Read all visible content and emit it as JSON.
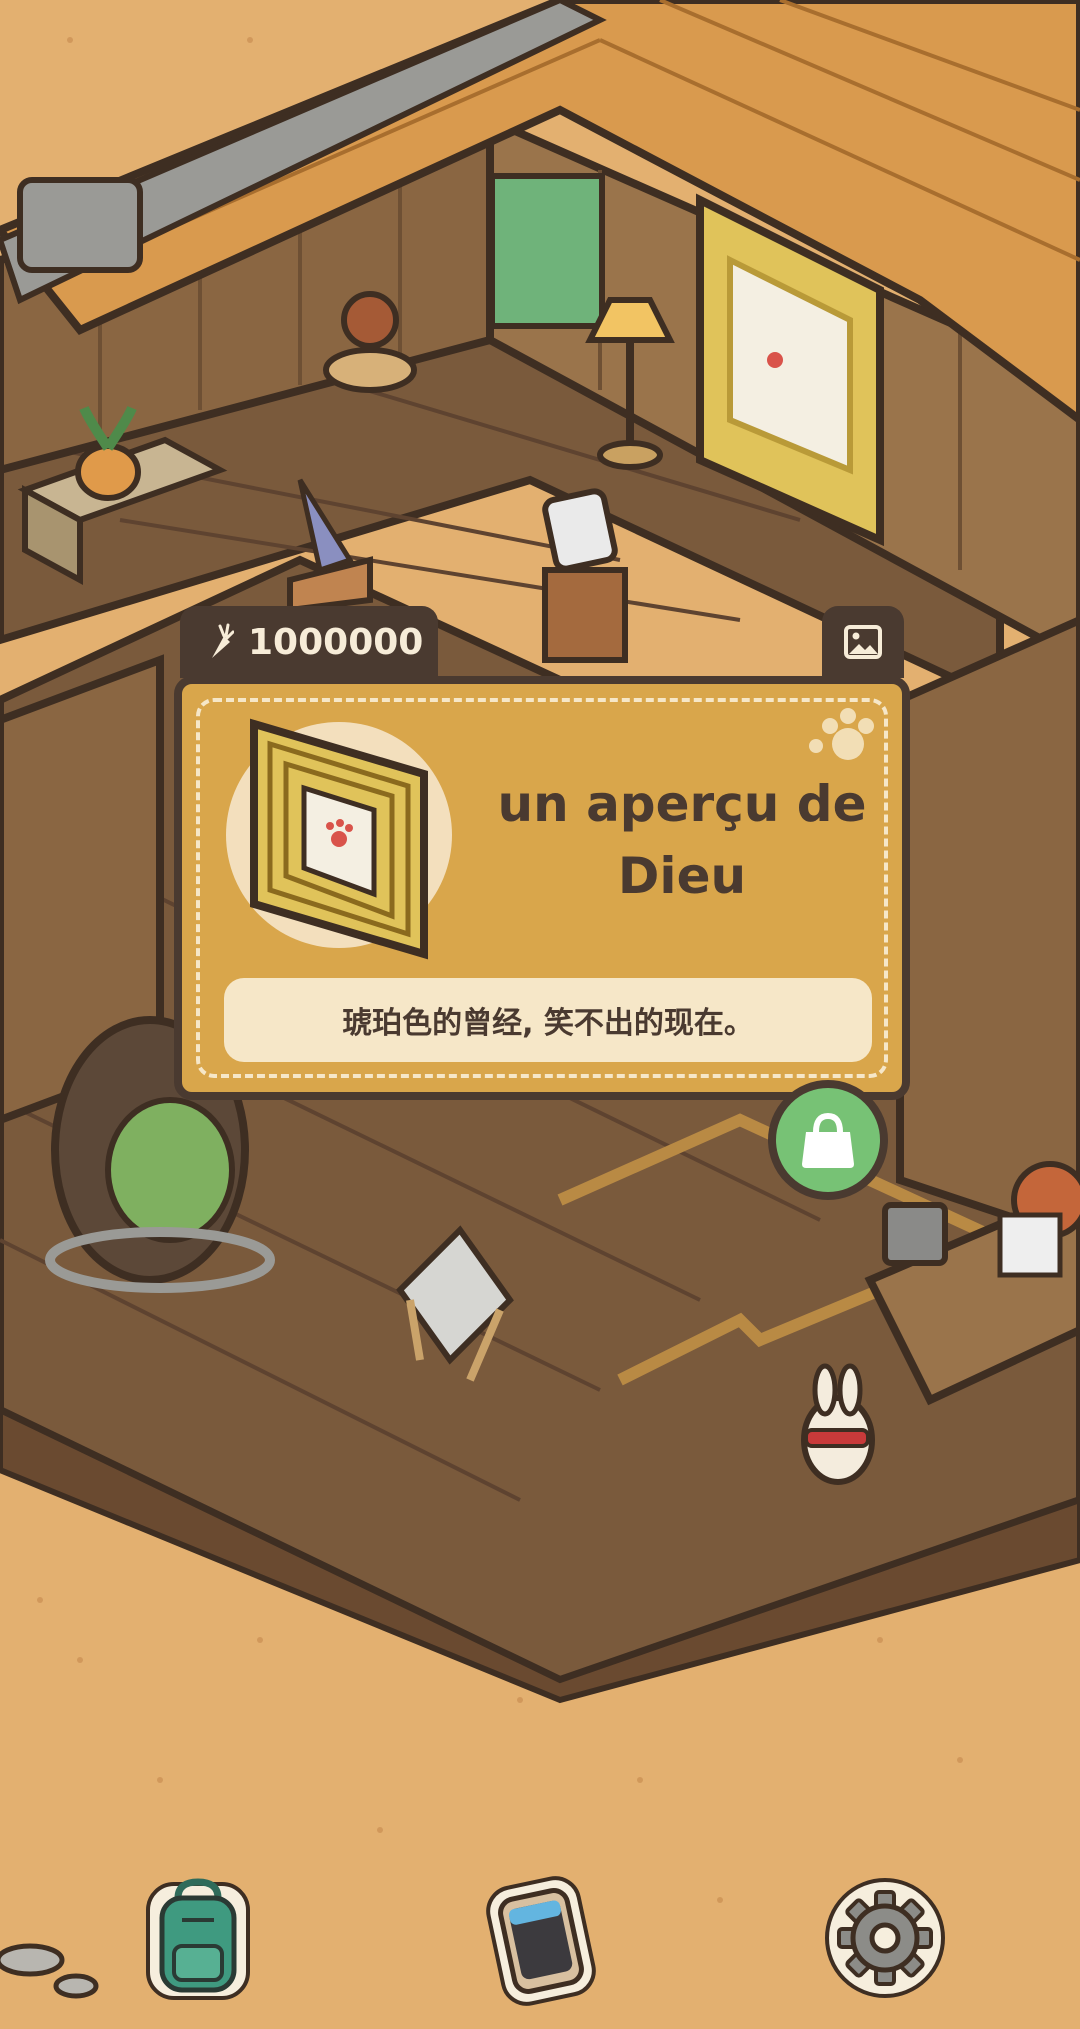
{
  "currency": {
    "icon": "carrot-icon",
    "amount": "1000000"
  },
  "photo_button": {
    "icon": "photo-icon"
  },
  "item_card": {
    "name": "un aperçu de Dieu",
    "description": "琥珀色的曾经, 笑不出的现在。",
    "image": "ornate-frame-painting-icon",
    "decoration": "paw-print-icon"
  },
  "bag_button": {
    "icon": "shopping-bag-icon"
  },
  "bottom_nav": {
    "items": [
      {
        "icon": "backpack-icon"
      },
      {
        "icon": "phone-icon"
      },
      {
        "icon": "gear-icon"
      }
    ]
  },
  "colors": {
    "ground": "#e3b070",
    "card": "#d9a64b",
    "card_border": "#4a3a30",
    "card_light": "#f6e7c8",
    "bag_green": "#77c275",
    "floor": "#7a5a3c",
    "wall": "#8a6642",
    "roof": "#d99a4e"
  }
}
